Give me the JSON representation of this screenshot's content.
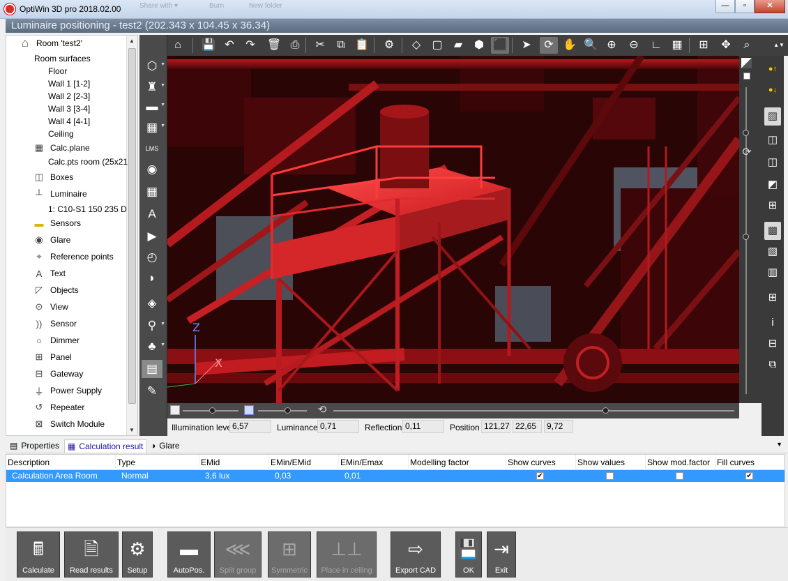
{
  "window": {
    "title": "OptiWin 3D pro 2018.02.00",
    "ghost_menu": [
      "Share with ▾",
      "Burn",
      "New folder"
    ],
    "buttons": {
      "minimize": "—",
      "maximize": "▫",
      "close": "✕"
    }
  },
  "subtitle": "Luminaire positioning - test2 (202.343 x 104.45 x 36.34)",
  "tree": {
    "items": [
      {
        "label": "Room 'test2'",
        "icon": "house-icon",
        "glyph": "⌂"
      },
      {
        "label": "Room surfaces",
        "icon": "",
        "glyph": ""
      },
      {
        "label": "Floor",
        "icon": "",
        "glyph": ""
      },
      {
        "label": "Wall 1 [1-2]",
        "icon": "",
        "glyph": ""
      },
      {
        "label": "Wall 2 [2-3]",
        "icon": "",
        "glyph": ""
      },
      {
        "label": "Wall 3 [3-4]",
        "icon": "",
        "glyph": ""
      },
      {
        "label": "Wall 4 [4-1]",
        "icon": "",
        "glyph": ""
      },
      {
        "label": "Ceiling",
        "icon": "",
        "glyph": ""
      },
      {
        "label": "Calc.plane",
        "icon": "grid-icon",
        "glyph": "▦"
      },
      {
        "label": "Calc.pts room (25x21",
        "icon": "",
        "glyph": ""
      },
      {
        "label": "Boxes",
        "icon": "box-icon",
        "glyph": "◫"
      },
      {
        "label": "Luminaire",
        "icon": "luminaire-icon",
        "glyph": "┴"
      },
      {
        "label": "1: C10-S1 150 235 D",
        "icon": "",
        "glyph": ""
      },
      {
        "label": "Sensors",
        "icon": "sensor-icon",
        "glyph": "▬"
      },
      {
        "label": "Glare",
        "icon": "eye-icon",
        "glyph": "◉"
      },
      {
        "label": "Reference points",
        "icon": "pin-icon",
        "glyph": "⌖"
      },
      {
        "label": "Text",
        "icon": "text-icon",
        "glyph": "A"
      },
      {
        "label": "Objects",
        "icon": "objects-icon",
        "glyph": "◸"
      },
      {
        "label": "View",
        "icon": "view-icon",
        "glyph": "⊙"
      },
      {
        "label": "Sensor",
        "icon": "wireless-icon",
        "glyph": "))"
      },
      {
        "label": "Dimmer",
        "icon": "dimmer-icon",
        "glyph": "○"
      },
      {
        "label": "Panel",
        "icon": "panel-icon",
        "glyph": "⊞"
      },
      {
        "label": "Gateway",
        "icon": "gateway-icon",
        "glyph": "⊟"
      },
      {
        "label": "Power Supply",
        "icon": "plug-icon",
        "glyph": "⏚"
      },
      {
        "label": "Repeater",
        "icon": "repeater-icon",
        "glyph": "↺"
      },
      {
        "label": "Switch Module",
        "icon": "switch-icon",
        "glyph": "⊠"
      }
    ]
  },
  "left_tools": [
    {
      "icon": "cube-icon",
      "glyph": "⬡",
      "drop": true
    },
    {
      "icon": "chair-icon",
      "glyph": "♜",
      "drop": true
    },
    {
      "icon": "luminaire-bar-icon",
      "glyph": "▬",
      "drop": true
    },
    {
      "icon": "calc-grid-icon",
      "glyph": "▦",
      "drop": true
    },
    {
      "icon": "lms-icon",
      "glyph": "LMS",
      "drop": false
    },
    {
      "icon": "eye-icon",
      "glyph": "◉",
      "drop": false
    },
    {
      "icon": "tiles-icon",
      "glyph": "▦",
      "drop": false
    },
    {
      "icon": "text-tool-icon",
      "glyph": "A",
      "drop": false
    },
    {
      "icon": "camera-icon",
      "glyph": "▶",
      "drop": false
    },
    {
      "icon": "gauge-icon",
      "glyph": "◴",
      "drop": false
    },
    {
      "icon": "shape-icon",
      "glyph": "◗",
      "drop": false
    },
    {
      "icon": "render-icon",
      "glyph": "◈",
      "drop": false
    },
    {
      "icon": "spotlight-icon",
      "glyph": "⚲",
      "drop": true
    },
    {
      "icon": "tree-lamp-icon",
      "glyph": "♣",
      "drop": true
    },
    {
      "icon": "pattern-icon",
      "glyph": "▤",
      "drop": false
    },
    {
      "icon": "note-icon",
      "glyph": "✎",
      "drop": false
    }
  ],
  "top_tools": [
    {
      "icon": "home-icon",
      "glyph": "⌂"
    },
    {
      "icon": "save-icon",
      "glyph": "💾"
    },
    {
      "icon": "undo-icon",
      "glyph": "↶"
    },
    {
      "icon": "redo-icon",
      "glyph": "↷"
    },
    {
      "icon": "delete-icon",
      "glyph": "🗑"
    },
    {
      "icon": "print-icon",
      "glyph": "⎙"
    },
    {
      "icon": "cut-icon",
      "glyph": "✂"
    },
    {
      "icon": "copy-icon",
      "glyph": "⧉"
    },
    {
      "icon": "paste-icon",
      "glyph": "📋"
    },
    {
      "icon": "settings-icon",
      "glyph": "⚙"
    },
    {
      "icon": "wireframe-icon",
      "glyph": "◇"
    },
    {
      "icon": "box-view-icon",
      "glyph": "▢"
    },
    {
      "icon": "flat-view-icon",
      "glyph": "▰"
    },
    {
      "icon": "shaded-view-icon",
      "glyph": "⬢"
    },
    {
      "icon": "render-view-icon",
      "glyph": "⬛"
    },
    {
      "icon": "pointer-icon",
      "glyph": "➤"
    },
    {
      "icon": "rotate-icon",
      "glyph": "⟳"
    },
    {
      "icon": "pan-hand-icon",
      "glyph": "✋"
    },
    {
      "icon": "zoom-icon",
      "glyph": "🔍"
    },
    {
      "icon": "zoom-in-icon",
      "glyph": "⊕"
    },
    {
      "icon": "zoom-out-icon",
      "glyph": "⊖"
    },
    {
      "icon": "measure-icon",
      "glyph": "∟"
    },
    {
      "icon": "grid-view-icon",
      "glyph": "▦"
    },
    {
      "icon": "fit-view-icon",
      "glyph": "⊞"
    },
    {
      "icon": "move-icon",
      "glyph": "✥"
    },
    {
      "icon": "zoom-window-icon",
      "glyph": "⌕"
    }
  ],
  "right_tools": [
    {
      "icon": "lamp-up-icon",
      "glyph": "●↑"
    },
    {
      "icon": "lamp-down-icon",
      "glyph": "●↓"
    },
    {
      "icon": "image-icon",
      "glyph": "▨"
    },
    {
      "icon": "cube-small-icon",
      "glyph": "◫"
    },
    {
      "icon": "cube-light-icon",
      "glyph": "◫"
    },
    {
      "icon": "cube-color-icon",
      "glyph": "◩"
    },
    {
      "icon": "cube-grid-icon",
      "glyph": "⊞"
    },
    {
      "icon": "color-scale-icon",
      "glyph": "▩"
    },
    {
      "icon": "gray-scale-icon",
      "glyph": "▧"
    },
    {
      "icon": "iso-lines-icon",
      "glyph": "▥"
    },
    {
      "icon": "grid-split-icon",
      "glyph": "⊞"
    },
    {
      "icon": "info-icon",
      "glyph": "i"
    },
    {
      "icon": "network-icon",
      "glyph": "⊟"
    },
    {
      "icon": "copy-doc-icon",
      "glyph": "⧉"
    }
  ],
  "info": {
    "illumination_label": "Illumination level",
    "illumination_value": "6,57",
    "luminance_label": "Luminance",
    "luminance_value": "0,71",
    "reflection_label": "Reflection",
    "reflection_value": "0,11",
    "position_label": "Position",
    "position_x": "121,27",
    "position_y": "22,65",
    "position_z": "9,72"
  },
  "tabs": [
    {
      "label": "Properties",
      "icon": "properties-icon",
      "glyph": "▤"
    },
    {
      "label": "Calculation result",
      "icon": "table-icon",
      "glyph": "▦"
    },
    {
      "label": "Glare",
      "icon": "glare-icon",
      "glyph": "◑"
    }
  ],
  "grid": {
    "columns": [
      "Description",
      "Type",
      "EMid",
      "EMin/EMid",
      "EMin/Emax",
      "Modelling factor",
      "Show curves",
      "Show values",
      "Show mod.factor",
      "Fill curves"
    ],
    "rows": [
      {
        "description": "Calculation Area Room",
        "type": "Normal",
        "emid": "3,6 lux",
        "emin_emid": "0,03",
        "emin_emax": "0,01",
        "modelling_factor": "",
        "show_curves": true,
        "show_values": false,
        "show_mod_factor": false,
        "fill_curves": true
      }
    ],
    "check_glyph": "✔"
  },
  "bottom_buttons": [
    {
      "label": "Calculate",
      "icon": "calculator-icon",
      "glyph": "🖩",
      "dim": false
    },
    {
      "label": "Read results",
      "icon": "document-icon",
      "glyph": "🗎",
      "dim": false
    },
    {
      "label": "Setup",
      "icon": "gears-icon",
      "glyph": "⚙",
      "dim": false
    },
    {
      "label": "AutoPos.",
      "icon": "autopos-icon",
      "glyph": "▬",
      "dim": false
    },
    {
      "label": "Split group",
      "icon": "split-icon",
      "glyph": "⋘",
      "dim": true
    },
    {
      "label": "Symmetric",
      "icon": "symmetric-icon",
      "glyph": "⊞",
      "dim": true
    },
    {
      "label": "Place in ceiling",
      "icon": "ceiling-icon",
      "glyph": "⊥⊥",
      "dim": true
    },
    {
      "label": "Export CAD",
      "icon": "export-icon",
      "glyph": "⇨",
      "dim": false
    },
    {
      "label": "OK",
      "icon": "ok-save-icon",
      "glyph": "💾",
      "dim": false
    },
    {
      "label": "Exit",
      "icon": "exit-icon",
      "glyph": "⇥",
      "dim": false
    }
  ],
  "colors": {
    "accent_selection": "#3399ff",
    "render_red": "#e3262a"
  }
}
